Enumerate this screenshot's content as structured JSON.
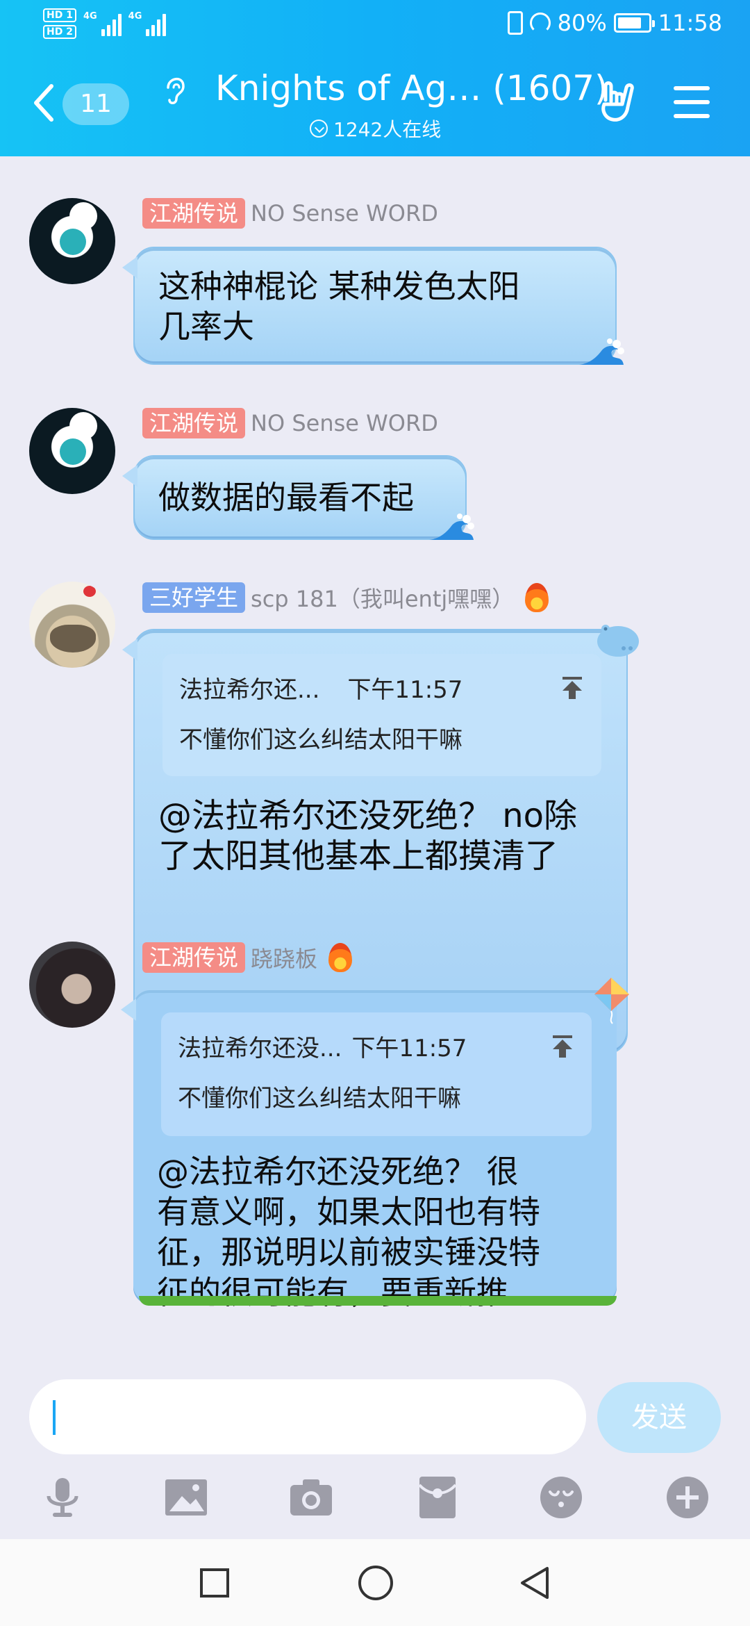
{
  "status_bar": {
    "hd1": "HD 1",
    "hd2": "HD 2",
    "net1": "4G",
    "net2": "4G",
    "battery_percent": "80%",
    "battery_level": 0.8,
    "time": "11:58"
  },
  "header": {
    "unread_count": "11",
    "title": "Knights of Ag… (1607)",
    "online_text": "1242人在线",
    "icons": [
      "back-chevron-icon",
      "ear-icon",
      "rock-hand-icon",
      "menu-icon"
    ]
  },
  "messages": [
    {
      "badge": "江湖传说",
      "badge_color": "#f48c86",
      "nickname": "NO Sense WORD",
      "lines": [
        "这种神棍论  某种发色太阳",
        "几率大"
      ]
    },
    {
      "badge": "江湖传说",
      "badge_color": "#f48c86",
      "nickname": "NO Sense WORD",
      "lines": [
        "做数据的最看不起"
      ]
    },
    {
      "badge": "三好学生",
      "badge_color": "#7aa6ee",
      "nickname": "scp 181（我叫entj嘿嘿）",
      "quote": {
        "name": "法拉希尔还...",
        "time": "下午11:57",
        "text": "不懂你们这么纠结太阳干嘛"
      },
      "lines": [
        "@法拉希尔还没死绝？ no除",
        "了太阳其他基本上都摸清了"
      ]
    },
    {
      "badge": "江湖传说",
      "badge_color": "#f48c86",
      "nickname": "跷跷板",
      "quote": {
        "name": "法拉希尔还没...",
        "time": "下午11:57",
        "text": "不懂你们这么纠结太阳干嘛"
      },
      "lines": [
        "@法拉希尔还没死绝？ 很",
        "有意义啊，如果太阳也有特",
        "征，那说明以前被实锤没特",
        "征的很可能有，要重新推"
      ]
    }
  ],
  "composer": {
    "input_value": "",
    "send_label": "发送"
  },
  "toolbar": [
    "microphone-icon",
    "image-icon",
    "camera-icon",
    "red-packet-icon",
    "emoji-icon",
    "plus-icon"
  ],
  "navbar": [
    "recent-apps-icon",
    "home-icon",
    "back-icon"
  ],
  "colors": {
    "header_start": "#16c3f5",
    "header_end": "#1aa3f3",
    "bubble": "#a8d6f8",
    "badge_red": "#f48c86",
    "badge_blue": "#7aa6ee",
    "send_button": "#bfe5fb"
  }
}
